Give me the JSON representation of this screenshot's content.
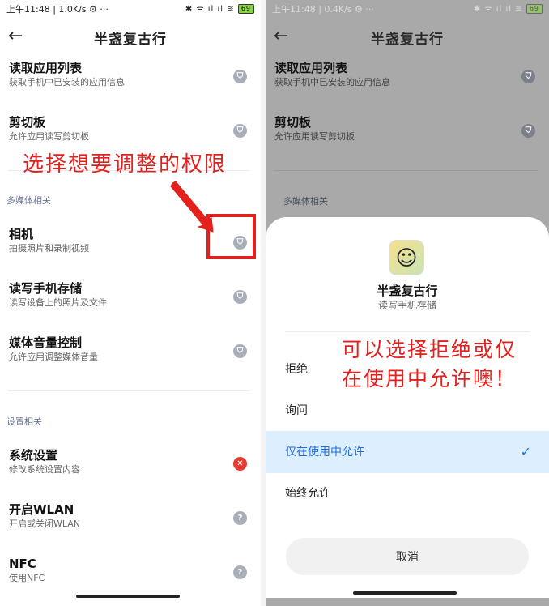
{
  "left": {
    "status": {
      "time": "上午11:48 | 1.0K/s ⚙ ···",
      "signal": "✱ ᯤ ıl ıl ≋",
      "battery": "69"
    },
    "title": "半盏复古行",
    "items_top": [
      {
        "name": "读取应用列表",
        "desc": "获取手机中已安装的应用信息"
      },
      {
        "name": "剪切板",
        "desc": "允许应用读写剪切板"
      }
    ],
    "section_media": "多媒体相关",
    "items_media": [
      {
        "name": "相机",
        "desc": "拍摄照片和录制视频"
      },
      {
        "name": "读写手机存储",
        "desc": "读写设备上的照片及文件"
      },
      {
        "name": "媒体音量控制",
        "desc": "允许应用调整媒体音量"
      }
    ],
    "section_settings": "设置相关",
    "items_settings": [
      {
        "name": "系统设置",
        "desc": "修改系统设置内容"
      },
      {
        "name": "开启WLAN",
        "desc": "开启或关闭WLAN"
      },
      {
        "name": "NFC",
        "desc": "使用NFC"
      }
    ],
    "annotation": "选择想要调整的权限"
  },
  "right": {
    "status": {
      "time": "上午11:48 | 0.4K/s ⚙ ···",
      "signal": "✱ ᯤ ıl ıl ≋",
      "battery": "69"
    },
    "title": "半盏复古行",
    "items_top": [
      {
        "name": "读取应用列表",
        "desc": "获取手机中已安装的应用信息"
      },
      {
        "name": "剪切板",
        "desc": "允许应用读写剪切板"
      }
    ],
    "section_media": "多媒体相关",
    "sheet": {
      "app_name": "半盏复古行",
      "permission": "读写手机存储",
      "options": [
        "拒绝",
        "询问",
        "仅在使用中允许",
        "始终允许"
      ],
      "selected_index": 2,
      "cancel": "取消"
    },
    "annotation_line1": "可以选择拒绝或仅",
    "annotation_line2": "在使用中允许噢！"
  },
  "icons": {
    "back": "←",
    "shield": "⛉",
    "question": "?",
    "error": "✕",
    "check": "✓",
    "avatar": "☺"
  },
  "colors": {
    "annotation_red": "#e4201d",
    "selected_blue": "#1f6ee0",
    "selected_bg": "#ddeefe"
  }
}
